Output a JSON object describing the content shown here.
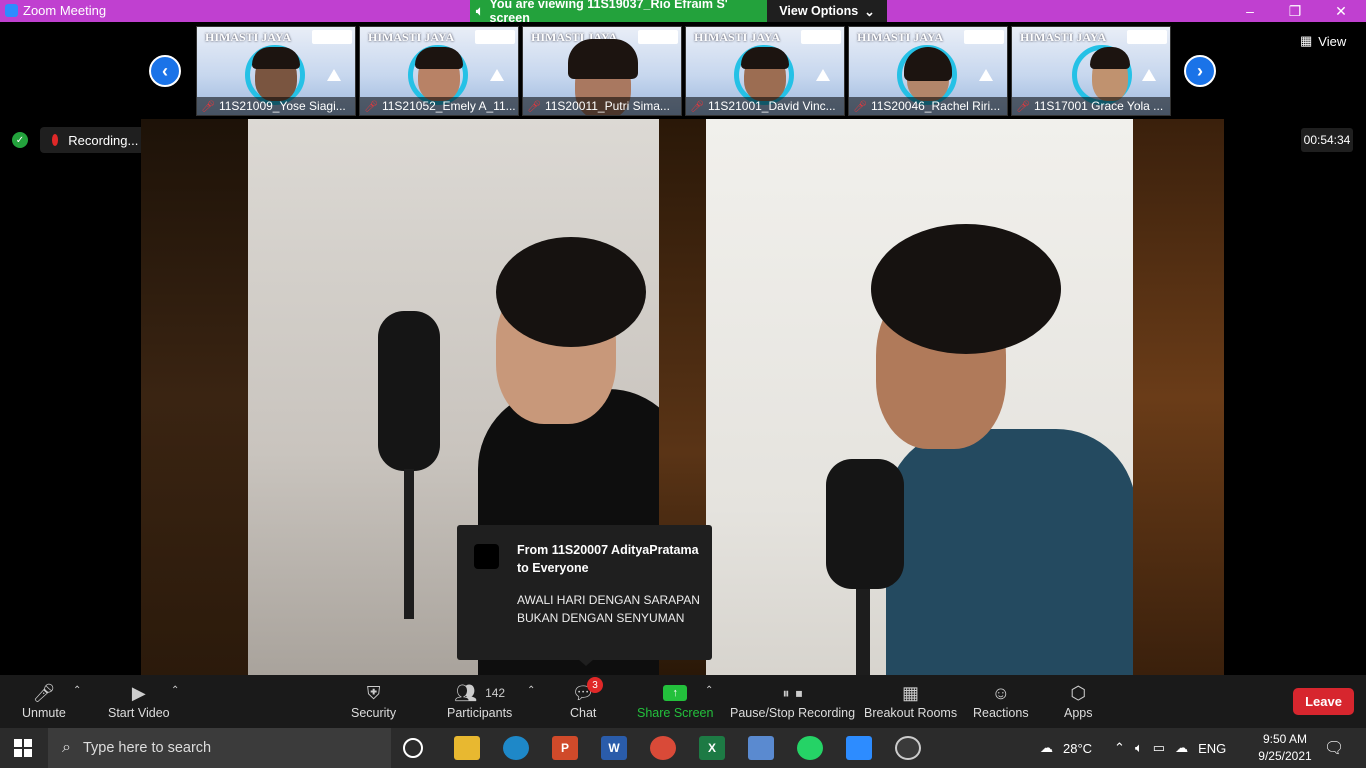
{
  "window": {
    "title": "Zoom Meeting",
    "banner": "You are viewing 11S19037_Rio Efraim S' screen",
    "view_options": "View Options",
    "controls": [
      "–",
      "❐",
      "✕"
    ]
  },
  "participants": [
    {
      "name": "11S21009_Yose Siagi...",
      "tag": "HIMASTI JAYA"
    },
    {
      "name": "11S21052_Emely A_11...",
      "tag": "HIMASTI JAYA"
    },
    {
      "name": "11S20011_Putri Sima...",
      "tag": "HIMASTI JAYA"
    },
    {
      "name": "11S21001_David Vinc...",
      "tag": "HIMASTI JAYA"
    },
    {
      "name": "11S20046_Rachel Riri...",
      "tag": "HIMASTI JAYA"
    },
    {
      "name": "11S17001 Grace Yola ...",
      "tag": "HIMASTI JAYA"
    }
  ],
  "view_button": "View",
  "recording": {
    "label": "Recording...",
    "timer": "00:54:34"
  },
  "chat_toast": {
    "from": "From 11S20007 AdityaPratama to Everyone",
    "message": "AWALI HARI DENGAN SARAPAN BUKAN DENGAN SENYUMAN"
  },
  "toolbar": {
    "unmute": "Unmute",
    "start_video": "Start Video",
    "security": "Security",
    "participants": "Participants",
    "participants_count": "142",
    "chat": "Chat",
    "chat_badge": "3",
    "share_screen": "Share Screen",
    "pause_stop_recording": "Pause/Stop Recording",
    "breakout_rooms": "Breakout Rooms",
    "reactions": "Reactions",
    "apps": "Apps",
    "leave": "Leave"
  },
  "taskbar": {
    "search_placeholder": "Type here to search",
    "weather": "28°C",
    "language": "ENG",
    "time": "9:50 AM",
    "date": "9/25/2021",
    "apps": [
      "cortana",
      "file-explorer",
      "edge",
      "powerpoint",
      "word",
      "chrome",
      "excel",
      "snipping-tool",
      "whatsapp",
      "zoom",
      "obs"
    ]
  },
  "colors": {
    "zoom_blue": "#2d8cff",
    "banner_green": "#23a23c",
    "leave_red": "#d7262e",
    "titlebar_purple": "#c040d0"
  }
}
